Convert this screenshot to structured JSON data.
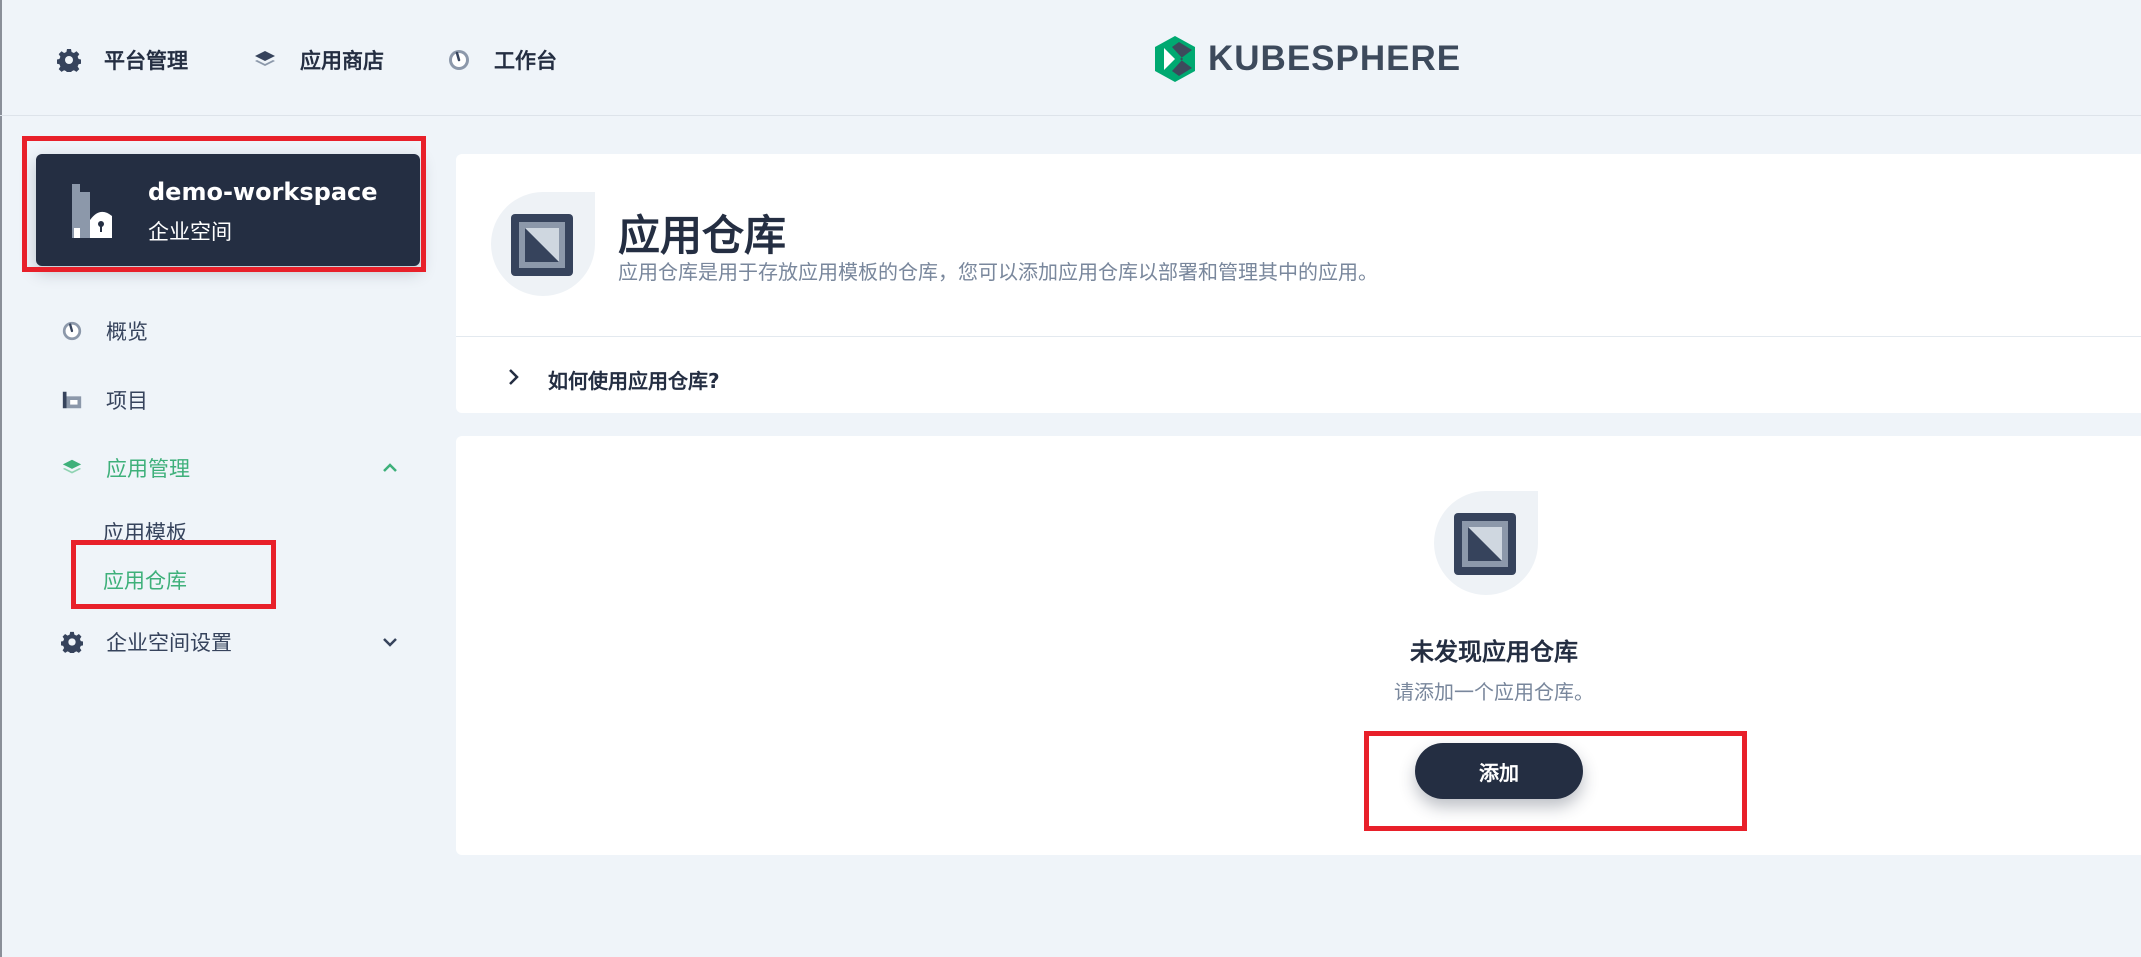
{
  "topnav": {
    "items": [
      {
        "label": "平台管理",
        "icon": "gear-icon"
      },
      {
        "label": "应用商店",
        "icon": "layers-icon"
      },
      {
        "label": "工作台",
        "icon": "dashboard-icon"
      }
    ],
    "logo_text": "KUBESPHERE"
  },
  "workspace": {
    "name": "demo-workspace",
    "type": "企业空间",
    "icon": "enterprise-icon"
  },
  "sidebar": {
    "items": [
      {
        "label": "概览",
        "icon": "dashboard-icon"
      },
      {
        "label": "项目",
        "icon": "project-icon"
      },
      {
        "label": "应用管理",
        "icon": "layers-icon",
        "expanded": true
      },
      {
        "label": "企业空间设置",
        "icon": "gear-icon",
        "expanded": false
      }
    ],
    "app_sub_items": [
      {
        "label": "应用模板"
      },
      {
        "label": "应用仓库",
        "active": true
      }
    ]
  },
  "banner": {
    "title": "应用仓库",
    "description": "应用仓库是用于存放应用模板的仓库，您可以添加应用仓库以部署和管理其中的应用。",
    "howto_label": "如何使用应用仓库?"
  },
  "empty_state": {
    "title": "未发现应用仓库",
    "description": "请添加一个应用仓库。",
    "button_label": "添加"
  },
  "colors": {
    "accent_green": "#3eb07a",
    "dark": "#242e42",
    "highlight_red": "#e8202a",
    "background": "#eff4f9"
  }
}
